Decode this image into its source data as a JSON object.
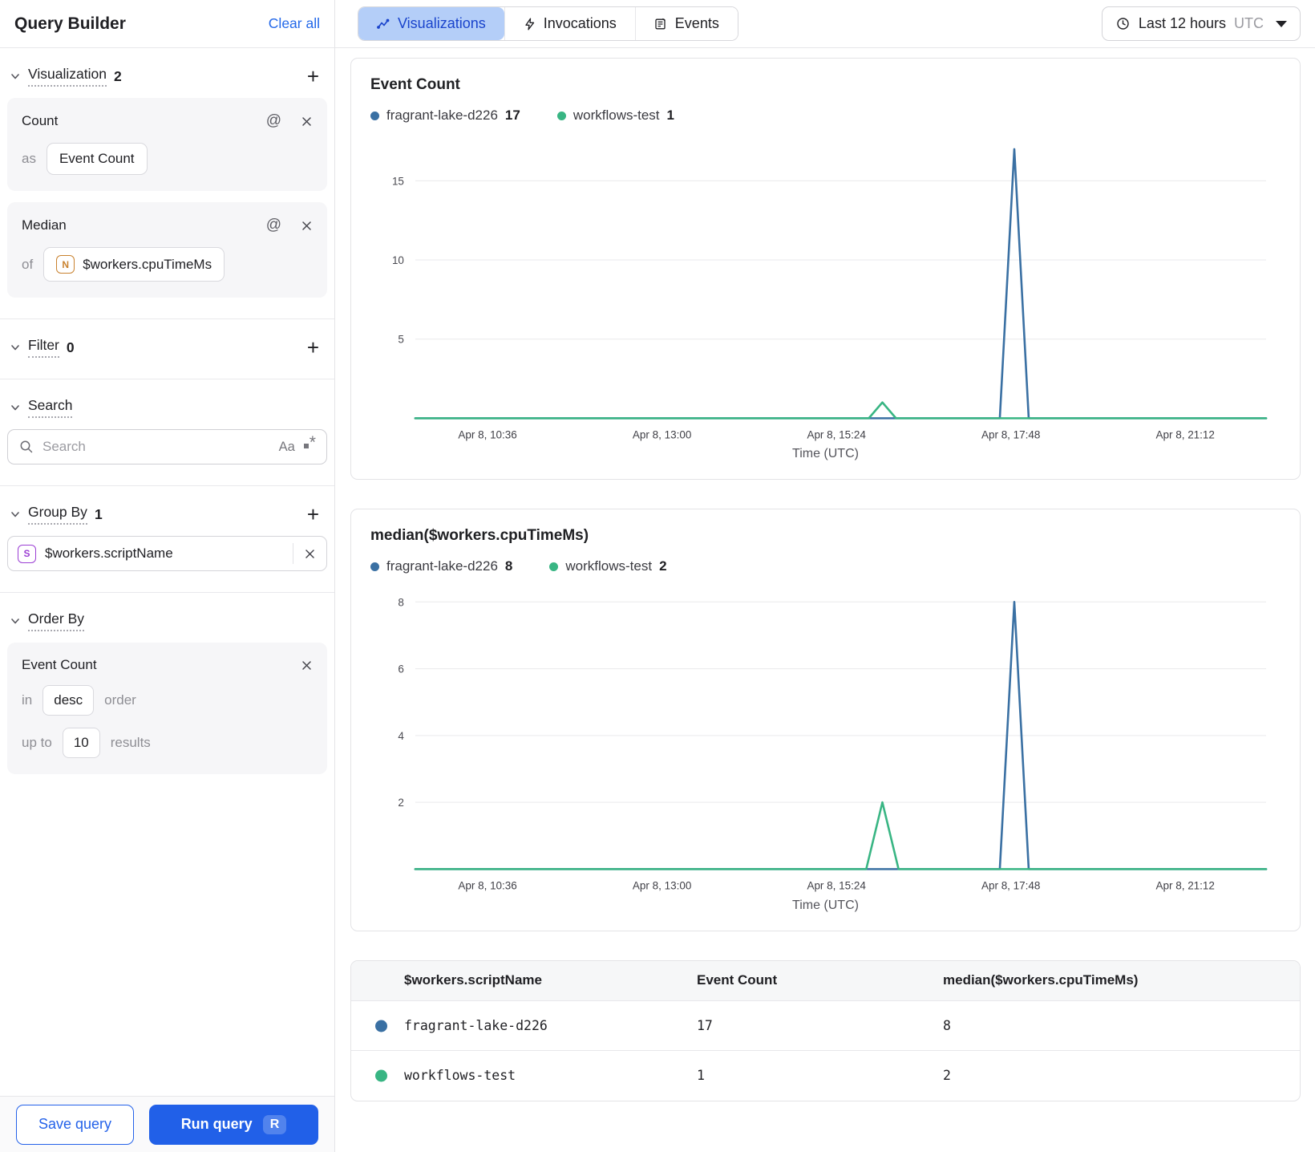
{
  "sidebar": {
    "title": "Query Builder",
    "clear_all_label": "Clear all",
    "visualization": {
      "label": "Visualization",
      "count": "2",
      "cards": [
        {
          "name": "Count",
          "prefix": "as",
          "value": "Event Count"
        },
        {
          "name": "Median",
          "prefix": "of",
          "value": "$workers.cpuTimeMs",
          "type_letter": "N"
        }
      ]
    },
    "filter": {
      "label": "Filter",
      "count": "0"
    },
    "search": {
      "label": "Search",
      "placeholder": "Search",
      "case_icon": "Aa"
    },
    "group_by": {
      "label": "Group By",
      "count": "1",
      "items": [
        {
          "type_letter": "S",
          "value": "$workers.scriptName"
        }
      ]
    },
    "order_by": {
      "label": "Order By",
      "field": "Event Count",
      "in_label": "in",
      "direction": "desc",
      "order_label": "order",
      "up_to_label": "up to",
      "limit": "10",
      "results_label": "results"
    },
    "save_label": "Save query",
    "run_label": "Run query",
    "run_shortcut": "R"
  },
  "tabs": [
    {
      "label": "Visualizations",
      "active": true
    },
    {
      "label": "Invocations",
      "active": false
    },
    {
      "label": "Events",
      "active": false
    }
  ],
  "time_range": {
    "label": "Last 12 hours",
    "zone": "UTC"
  },
  "colors": {
    "series_blue": "#3a70a3",
    "series_green": "#38b583",
    "accent_blue": "#2368e9",
    "active_tab_bg": "#b4cef8",
    "active_tab_text": "#1a44cc"
  },
  "chart_data": [
    {
      "type": "line",
      "title": "Event Count",
      "xlabel": "Time (UTC)",
      "legend_position": "top",
      "grid": true,
      "legend": [
        {
          "name": "fragrant-lake-d226",
          "value": 17,
          "color": "#3a70a3"
        },
        {
          "name": "workflows-test",
          "value": 1,
          "color": "#38b583"
        }
      ],
      "x_tick_labels": [
        "Apr 8, 10:36",
        "Apr 8, 13:00",
        "Apr 8, 15:24",
        "Apr 8, 17:48",
        "Apr 8, 21:12"
      ],
      "x_tick_fractions": [
        0.085,
        0.29,
        0.495,
        0.7,
        0.905
      ],
      "ylim": [
        0,
        17.3
      ],
      "yticks": [
        5,
        10,
        15
      ],
      "series": [
        {
          "name": "fragrant-lake-d226",
          "color": "#3a70a3",
          "points": [
            [
              0,
              0
            ],
            [
              0.687,
              0
            ],
            [
              0.704,
              17
            ],
            [
              0.721,
              0
            ],
            [
              1,
              0
            ]
          ]
        },
        {
          "name": "workflows-test",
          "color": "#38b583",
          "points": [
            [
              0,
              0
            ],
            [
              0.533,
              0
            ],
            [
              0.549,
              1
            ],
            [
              0.565,
              0
            ],
            [
              1,
              0
            ]
          ]
        }
      ]
    },
    {
      "type": "line",
      "title": "median($workers.cpuTimeMs)",
      "xlabel": "Time (UTC)",
      "legend_position": "top",
      "grid": true,
      "legend": [
        {
          "name": "fragrant-lake-d226",
          "value": 8,
          "color": "#3a70a3"
        },
        {
          "name": "workflows-test",
          "value": 2,
          "color": "#38b583"
        }
      ],
      "x_tick_labels": [
        "Apr 8, 10:36",
        "Apr 8, 13:00",
        "Apr 8, 15:24",
        "Apr 8, 17:48",
        "Apr 8, 21:12"
      ],
      "x_tick_fractions": [
        0.085,
        0.29,
        0.495,
        0.7,
        0.905
      ],
      "ylim": [
        0,
        8.2
      ],
      "yticks": [
        2,
        4,
        6,
        8
      ],
      "series": [
        {
          "name": "fragrant-lake-d226",
          "color": "#3a70a3",
          "points": [
            [
              0,
              0
            ],
            [
              0.687,
              0
            ],
            [
              0.704,
              8
            ],
            [
              0.721,
              0
            ],
            [
              1,
              0
            ]
          ]
        },
        {
          "name": "workflows-test",
          "color": "#38b583",
          "points": [
            [
              0,
              0
            ],
            [
              0.53,
              0
            ],
            [
              0.549,
              2
            ],
            [
              0.568,
              0
            ],
            [
              1,
              0
            ]
          ]
        }
      ]
    }
  ],
  "table": {
    "columns": [
      "$workers.scriptName",
      "Event Count",
      "median($workers.cpuTimeMs)"
    ],
    "rows": [
      {
        "color": "#3a70a3",
        "cells": [
          "fragrant-lake-d226",
          "17",
          "8"
        ]
      },
      {
        "color": "#38b583",
        "cells": [
          "workflows-test",
          "1",
          "2"
        ]
      }
    ]
  }
}
